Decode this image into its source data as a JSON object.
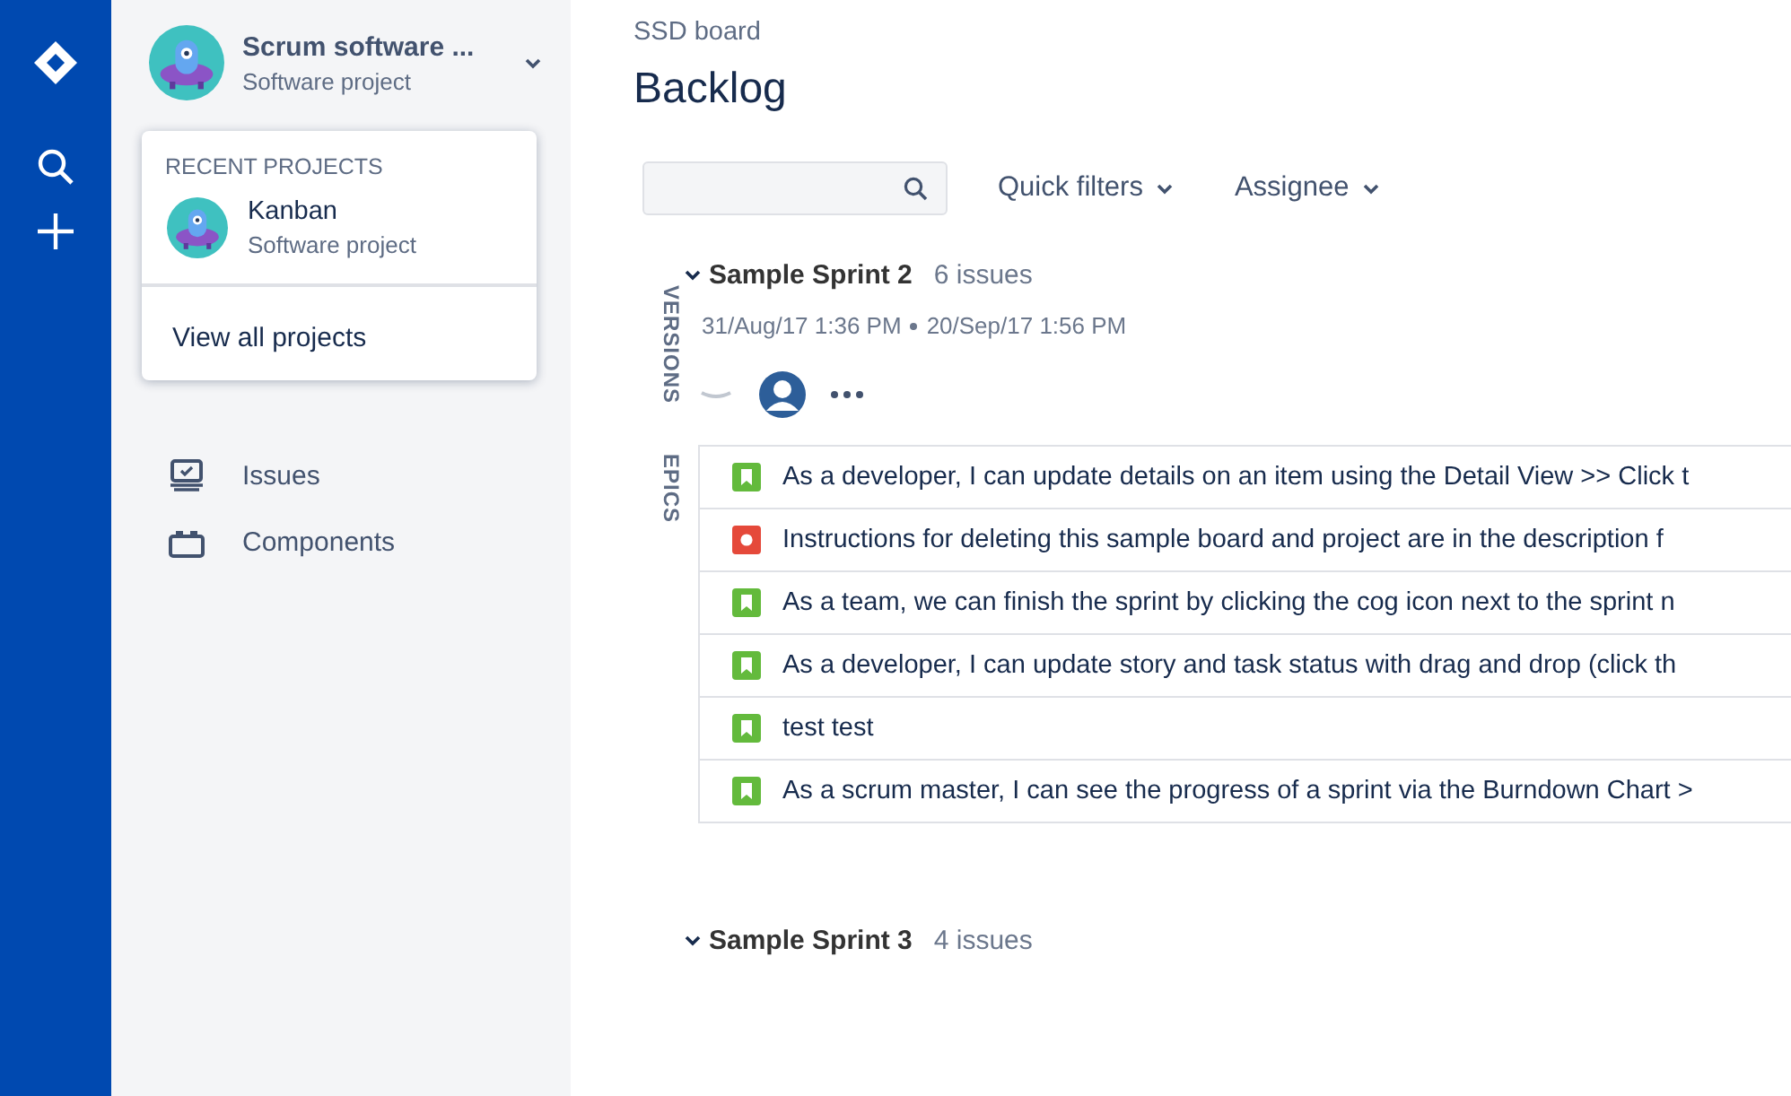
{
  "project": {
    "name": "Scrum software ...",
    "type": "Software project"
  },
  "recent_projects": {
    "heading": "RECENT PROJECTS",
    "items": [
      {
        "name": "Kanban",
        "type": "Software project"
      }
    ],
    "view_all": "View all projects"
  },
  "sidebar": {
    "items": [
      {
        "label": "Issues"
      },
      {
        "label": "Components"
      }
    ]
  },
  "breadcrumb": "SSD board",
  "title": "Backlog",
  "filters": [
    "Quick filters",
    "Assignee"
  ],
  "side_tabs": [
    "VERSIONS",
    "EPICS"
  ],
  "sprints": [
    {
      "name": "Sample Sprint 2",
      "count": "6 issues",
      "dates": "31/Aug/17 1:36 PM",
      "end": "20/Sep/17 1:56 PM",
      "issues": [
        {
          "kind": "story",
          "summary": "As a developer, I can update details on an item using the Detail View >> Click t"
        },
        {
          "kind": "bug",
          "summary": "Instructions for deleting this sample board and project are in the description f"
        },
        {
          "kind": "story",
          "summary": "As a team, we can finish the sprint by clicking the cog icon next to the sprint n"
        },
        {
          "kind": "story",
          "summary": "As a developer, I can update story and task status with drag and drop (click th"
        },
        {
          "kind": "story",
          "summary": "test test"
        },
        {
          "kind": "story",
          "summary": "As a scrum master, I can see the progress of a sprint via the Burndown Chart >"
        }
      ]
    },
    {
      "name": "Sample Sprint 3",
      "count": "4 issues"
    }
  ]
}
